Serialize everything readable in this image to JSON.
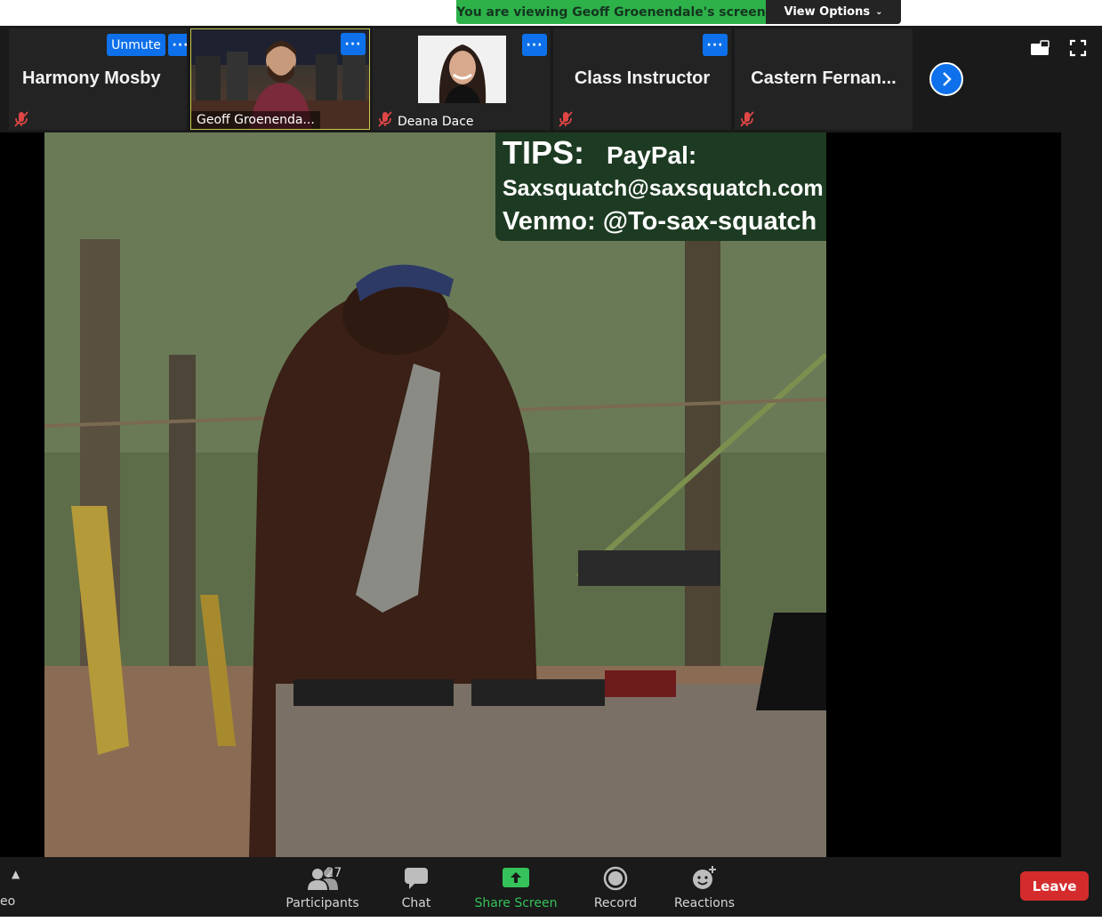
{
  "banner": {
    "viewing_text": "You are viewing Geoff Groenendale's screen",
    "view_options_label": "View Options"
  },
  "participants_strip": {
    "tiles": [
      {
        "name": "Harmony Mosby",
        "unmute_label": "Unmute",
        "more": "···"
      },
      {
        "name": "Geoff Groenenda...",
        "more": "···"
      },
      {
        "name": "Deana Dace",
        "more": "···"
      },
      {
        "name": "Class Instructor",
        "more": "···"
      },
      {
        "name": "Castern  Fernan..."
      }
    ]
  },
  "shared_screen": {
    "tips_title": "TIPS:",
    "tips_paypal": "PayPal:",
    "tips_email": "Saxsquatch@saxsquatch.com",
    "tips_venmo": "Venmo: @To-sax-squatch"
  },
  "toolbar": {
    "participants_label": "Participants",
    "participants_count": "27",
    "chat_label": "Chat",
    "share_label": "Share Screen",
    "record_label": "Record",
    "reactions_label": "Reactions",
    "leave_label": "Leave",
    "partial_label": "eo"
  },
  "colors": {
    "accent_blue": "#0e71eb",
    "banner_green": "#2db24a",
    "share_green": "#35c25a",
    "leave_red": "#d42c2c"
  }
}
